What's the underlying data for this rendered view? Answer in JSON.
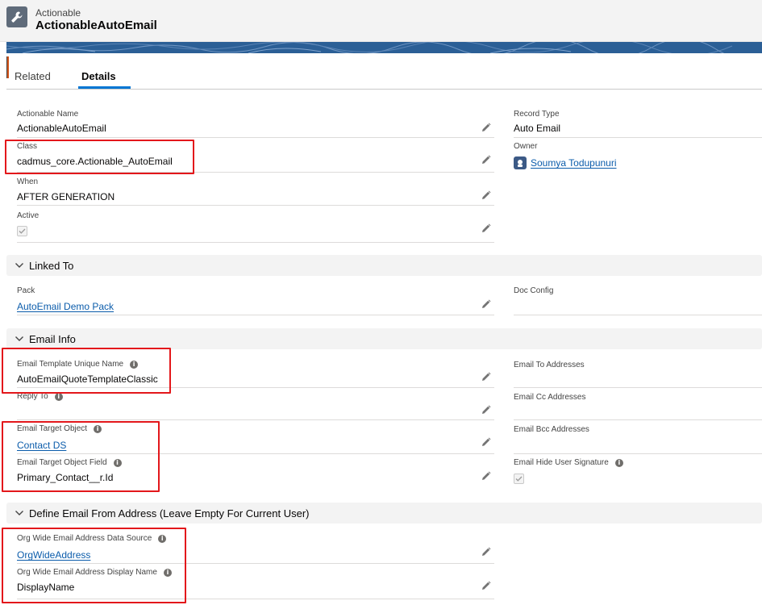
{
  "header": {
    "object_label": "Actionable",
    "title": "ActionableAutoEmail",
    "icon": "wrench-icon"
  },
  "tabs": [
    {
      "label": "Related",
      "active": false
    },
    {
      "label": "Details",
      "active": true
    }
  ],
  "fields": {
    "actionable_name": {
      "label": "Actionable Name",
      "value": "ActionableAutoEmail"
    },
    "record_type": {
      "label": "Record Type",
      "value": "Auto Email"
    },
    "class": {
      "label": "Class",
      "value": "cadmus_core.Actionable_AutoEmail"
    },
    "owner": {
      "label": "Owner",
      "value": "Soumya Todupunuri"
    },
    "when": {
      "label": "When",
      "value": "AFTER GENERATION"
    },
    "active": {
      "label": "Active",
      "checked": true
    },
    "pack": {
      "label": "Pack",
      "value": "AutoEmail Demo Pack"
    },
    "doc_config": {
      "label": "Doc Config",
      "value": ""
    },
    "email_template_unique_name": {
      "label": "Email Template Unique Name",
      "value": "AutoEmailQuoteTemplateClassic"
    },
    "email_to_addresses": {
      "label": "Email To Addresses",
      "value": ""
    },
    "reply_to": {
      "label": "Reply To",
      "value": ""
    },
    "email_cc_addresses": {
      "label": "Email Cc Addresses",
      "value": ""
    },
    "email_target_object": {
      "label": "Email Target Object",
      "value": "Contact DS"
    },
    "email_bcc_addresses": {
      "label": "Email Bcc Addresses",
      "value": ""
    },
    "email_target_object_field": {
      "label": "Email Target Object Field",
      "value": "Primary_Contact__r.Id"
    },
    "email_hide_user_signature": {
      "label": "Email Hide User Signature",
      "checked": true
    },
    "org_wide_email_address_data_source": {
      "label": "Org Wide Email Address Data Source",
      "value": "OrgWideAddress"
    },
    "org_wide_email_address_display_name": {
      "label": "Org Wide Email Address Display Name",
      "value": "DisplayName"
    }
  },
  "sections": {
    "linked_to": "Linked To",
    "email_info": "Email Info",
    "define_email_from": "Define Email From Address (Leave Empty For Current User)"
  },
  "colors": {
    "link": "#0b5cab",
    "tab_active": "#0176d3",
    "highlight": "#e3171b",
    "banner": "#2b5f96"
  }
}
